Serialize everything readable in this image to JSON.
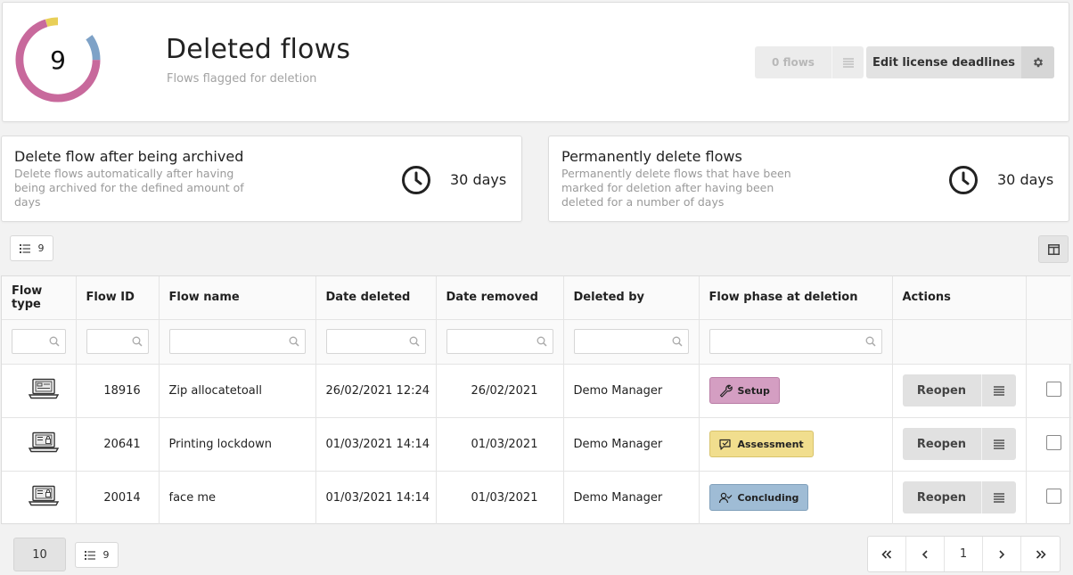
{
  "header": {
    "count": "9",
    "title": "Deleted flows",
    "subtitle": "Flows flagged for deletion",
    "flows_button_label": "0 flows",
    "edit_button_label": "Edit license deadlines",
    "donut_colors": [
      "#c8699c",
      "#e8cf58",
      "#7ea2c7"
    ]
  },
  "info_cards": [
    {
      "title": "Delete flow after being archived",
      "description": "Delete flows automatically after having being archived for the defined amount of days",
      "days": "30 days"
    },
    {
      "title": "Permanently delete flows",
      "description": "Permanently delete flows that have been marked for deletion after having been deleted for a number of days",
      "days": "30 days"
    }
  ],
  "toolbar": {
    "count": "9"
  },
  "table": {
    "columns": [
      "Flow type",
      "Flow ID",
      "Flow name",
      "Date deleted",
      "Date removed",
      "Deleted by",
      "Flow phase at deletion",
      "Actions"
    ],
    "rows": [
      {
        "type_icon": "laptop-form-icon",
        "id": "18916",
        "name": "Zip allocatetoall",
        "date_deleted": "26/02/2021 12:24",
        "date_removed": "26/02/2021",
        "deleted_by": "Demo Manager",
        "phase": "Setup",
        "phase_icon": "wrench-icon",
        "action": "Reopen"
      },
      {
        "type_icon": "laptop-lock-icon",
        "id": "20641",
        "name": "Printing lockdown",
        "date_deleted": "01/03/2021 14:14",
        "date_removed": "01/03/2021",
        "deleted_by": "Demo Manager",
        "phase": "Assessment",
        "phase_icon": "chat-check-icon",
        "action": "Reopen"
      },
      {
        "type_icon": "laptop-lock-icon",
        "id": "20014",
        "name": "face me",
        "date_deleted": "01/03/2021 14:14",
        "date_removed": "01/03/2021",
        "deleted_by": "Demo Manager",
        "phase": "Concluding",
        "phase_icon": "person-check-icon",
        "action": "Reopen"
      }
    ]
  },
  "footer": {
    "page_size": "10",
    "count": "9",
    "current_page": "1"
  }
}
